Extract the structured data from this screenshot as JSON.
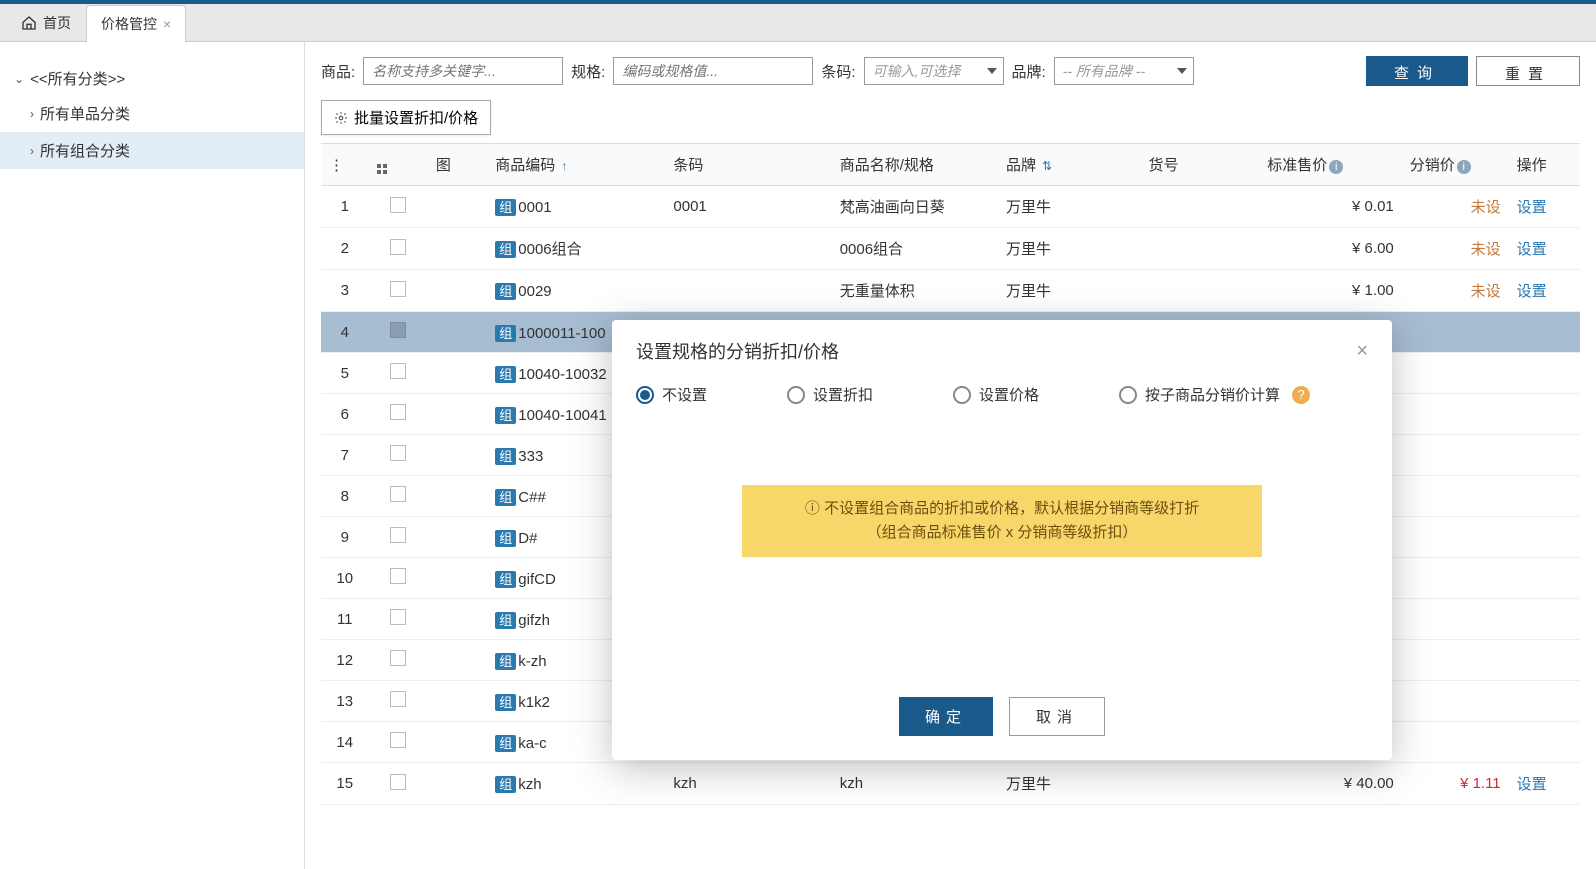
{
  "tabs": {
    "home": "首页",
    "active": "价格管控"
  },
  "sidebar": {
    "root": "<<所有分类>>",
    "children": [
      "所有单品分类",
      "所有组合分类"
    ],
    "active_index": 1
  },
  "filters": {
    "product_label": "商品:",
    "product_ph": "名称支持多关键字...",
    "spec_label": "规格:",
    "spec_ph": "编码或规格值...",
    "barcode_label": "条码:",
    "barcode_ph": "可输入,可选择",
    "brand_label": "品牌:",
    "brand_ph": "-- 所有品牌 --",
    "search_btn": "查询",
    "reset_btn": "重置"
  },
  "batch_btn": "批量设置折扣/价格",
  "columns": {
    "img": "图",
    "code": "商品编码",
    "barcode": "条码",
    "name": "商品名称/规格",
    "brand": "品牌",
    "sku": "货号",
    "std_price": "标准售价",
    "dist_price": "分销价",
    "action": "操作"
  },
  "badge_zu": "组",
  "rows": [
    {
      "idx": "1",
      "code": "0001",
      "bar": "0001",
      "name": "梵高油画向日葵",
      "brand": "万里牛",
      "price": "¥ 0.01",
      "dist": "未设",
      "op": "设置"
    },
    {
      "idx": "2",
      "code": "0006组合",
      "bar": "",
      "name": "0006组合",
      "brand": "万里牛",
      "price": "¥ 6.00",
      "dist": "未设",
      "op": "设置"
    },
    {
      "idx": "3",
      "code": "0029",
      "bar": "",
      "name": "无重量体积",
      "brand": "万里牛",
      "price": "¥ 1.00",
      "dist": "未设",
      "op": "设置"
    },
    {
      "idx": "4",
      "code": "1000011-100",
      "bar": "",
      "name": "",
      "brand": "",
      "price": "",
      "dist": "",
      "op": "",
      "sel": true
    },
    {
      "idx": "5",
      "code": "10040-10032",
      "bar": "",
      "name": "",
      "brand": "",
      "price": "",
      "dist": "",
      "op": ""
    },
    {
      "idx": "6",
      "code": "10040-10041",
      "bar": "",
      "name": "",
      "brand": "",
      "price": "",
      "dist": "",
      "op": ""
    },
    {
      "idx": "7",
      "code": "333",
      "bar": "",
      "name": "",
      "brand": "",
      "price": "",
      "dist": "",
      "op": ""
    },
    {
      "idx": "8",
      "code": "C##",
      "bar": "",
      "name": "",
      "brand": "",
      "price": "",
      "dist": "",
      "op": ""
    },
    {
      "idx": "9",
      "code": "D#",
      "bar": "",
      "name": "",
      "brand": "",
      "price": "",
      "dist": "",
      "op": ""
    },
    {
      "idx": "10",
      "code": "gifCD",
      "bar": "",
      "name": "",
      "brand": "",
      "price": "",
      "dist": "",
      "op": ""
    },
    {
      "idx": "11",
      "code": "gifzh",
      "bar": "",
      "name": "",
      "brand": "",
      "price": "",
      "dist": "",
      "op": ""
    },
    {
      "idx": "12",
      "code": "k-zh",
      "bar": "",
      "name": "",
      "brand": "",
      "price": "",
      "dist": "",
      "op": ""
    },
    {
      "idx": "13",
      "code": "k1k2",
      "bar": "",
      "name": "",
      "brand": "",
      "price": "",
      "dist": "",
      "op": ""
    },
    {
      "idx": "14",
      "code": "ka-c",
      "bar": "",
      "name": "",
      "brand": "",
      "price": "",
      "dist": "",
      "op": ""
    },
    {
      "idx": "15",
      "code": "kzh",
      "bar": "kzh",
      "name": "kzh",
      "brand": "万里牛",
      "price": "¥ 40.00",
      "dist": "¥ 1.11",
      "op": "设置",
      "dist_red": true
    }
  ],
  "modal": {
    "title": "设置规格的分销折扣/价格",
    "options": [
      "不设置",
      "设置折扣",
      "设置价格",
      "按子商品分销价计算"
    ],
    "selected": 0,
    "yellow_line1": "不设置组合商品的折扣或价格，默认根据分销商等级打折",
    "yellow_line2": "（组合商品标准售价 x 分销商等级折扣）",
    "ok": "确定",
    "cancel": "取消"
  }
}
